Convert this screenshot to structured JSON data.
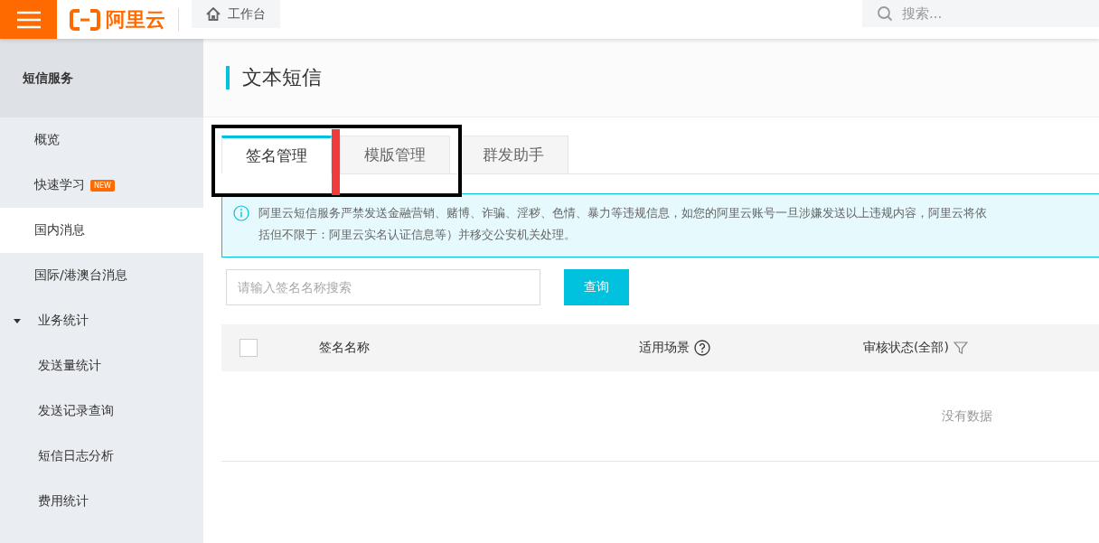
{
  "topbar": {
    "logo_text": "阿里云",
    "home_tab": "工作台",
    "search": {
      "placeholder": "搜索..."
    }
  },
  "sidebar": {
    "title": "短信服务",
    "items": [
      {
        "label": "概览",
        "selected": false
      },
      {
        "label": "快速学习",
        "badge": "NEW",
        "selected": false
      },
      {
        "label": "国内消息",
        "selected": true
      },
      {
        "label": "国际/港澳台消息",
        "selected": false
      },
      {
        "label": "业务统计",
        "expanded": true,
        "selected": false,
        "children": [
          {
            "label": "发送量统计",
            "selected": false
          },
          {
            "label": "发送记录查询",
            "selected": false
          },
          {
            "label": "短信日志分析",
            "selected": false
          },
          {
            "label": "费用统计",
            "selected": false
          }
        ]
      }
    ]
  },
  "page": {
    "title": "文本短信"
  },
  "tabs": [
    {
      "label": "签名管理",
      "selected": true
    },
    {
      "label": "模版管理",
      "selected": false
    },
    {
      "label": "群发助手",
      "selected": false
    }
  ],
  "annotations": [
    {
      "kind": "box",
      "color": "#000000"
    },
    {
      "kind": "bar",
      "color": "#ee3b3b"
    }
  ],
  "notice": {
    "lines": [
      "阿里云短信服务严禁发送金融营销、赌博、诈骗、淫秽、色情、暴力等违规信息，如您的阿里云账号一旦涉嫌发送以上违规内容，阿里云将依",
      "括但不限于：阿里云实名认证信息等）并移交公安机关处理。"
    ]
  },
  "filter": {
    "placeholder": "请输入签名名称搜索",
    "button": "查询"
  },
  "table": {
    "select_all": {
      "checked": false
    },
    "columns": [
      {
        "label": "签名名称",
        "kind": "plain"
      },
      {
        "label": "适用场景",
        "kind": "help"
      },
      {
        "label": "审核状态(全部)",
        "kind": "filter"
      }
    ],
    "empty_text": "没有数据"
  }
}
